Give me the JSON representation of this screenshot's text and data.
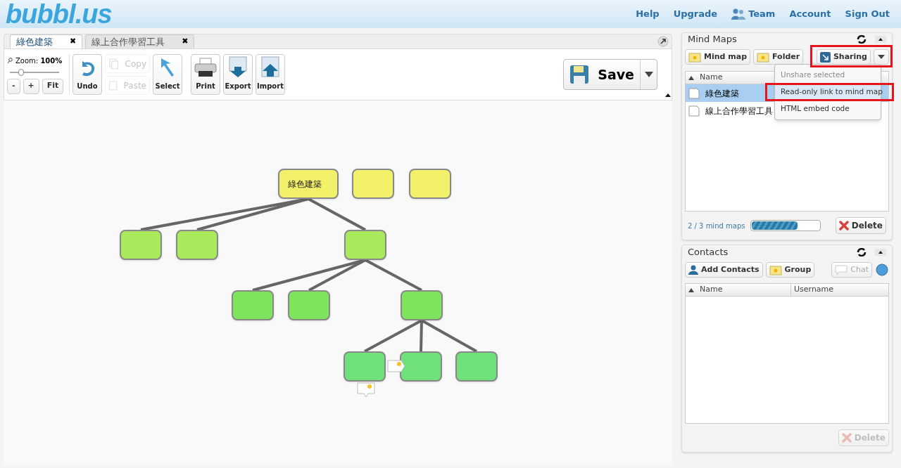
{
  "header": {
    "logo": "bubbl.us",
    "nav": [
      "Help",
      "Upgrade",
      "Team",
      "Account",
      "Sign Out"
    ]
  },
  "tabs": [
    {
      "label": "綠色建築",
      "selected": true,
      "close": "✖"
    },
    {
      "label": "線上合作學習工具",
      "selected": false,
      "close": "✖"
    }
  ],
  "toolbar": {
    "zoom_label": "Zoom:",
    "zoom_value": "100%",
    "level": 0.2,
    "zoom_buttons": [
      "-",
      "+",
      "Fit"
    ],
    "buttons": [
      {
        "label": "Undo",
        "kind": "undo",
        "disabled": false
      },
      {
        "label": "Copy",
        "kind": "copy",
        "disabled": true
      },
      {
        "label": "Paste",
        "kind": "paste",
        "disabled": true
      },
      {
        "label": "Select",
        "kind": "select",
        "disabled": false
      },
      {
        "label": "Print",
        "kind": "print",
        "disabled": false
      },
      {
        "label": "Export",
        "kind": "export",
        "disabled": false
      },
      {
        "label": "Import",
        "kind": "import",
        "disabled": false
      }
    ],
    "save": "Save"
  },
  "canvas": {
    "nodes": [
      {
        "label": "綠色建築",
        "color": "#f3f06a",
        "children": [
          {
            "color": "#a8ea5c"
          },
          {
            "color": "#a8ea5c"
          },
          {
            "color": "#a8ea5c",
            "children": [
              {
                "color": "#7ee45e"
              },
              {
                "color": "#7ee45e"
              },
              {
                "color": "#7ee45e",
                "children": [
                  {
                    "color": "#6fe07a"
                  },
                  {
                    "color": "#6fe07a"
                  },
                  {
                    "color": "#6fe07a"
                  }
                ]
              }
            ]
          }
        ]
      },
      {
        "color": "#f3f06a"
      },
      {
        "color": "#f3f06a"
      }
    ]
  },
  "mind_maps": {
    "title": "Mind Maps",
    "buttons": [
      "Mind map",
      "Folder",
      "Sharing"
    ],
    "column": "Name",
    "rows": [
      {
        "name": "綠色建築",
        "selected": true
      },
      {
        "name": "線上合作學習工具",
        "selected": false
      }
    ],
    "menu": [
      {
        "label": "Unshare selected",
        "disabled": true,
        "selected": false
      },
      {
        "label": "Read-only link to mind map",
        "disabled": false,
        "selected": true
      },
      {
        "label": "HTML embed code",
        "disabled": false,
        "selected": false
      }
    ],
    "usage": "2 / 3 mind maps",
    "level": 0.67,
    "delete": "Delete"
  },
  "contacts": {
    "title": "Contacts",
    "buttons": [
      "Add Contacts",
      "Group",
      "Chat"
    ],
    "columns": [
      "Name",
      "Username"
    ],
    "delete": "Delete"
  }
}
